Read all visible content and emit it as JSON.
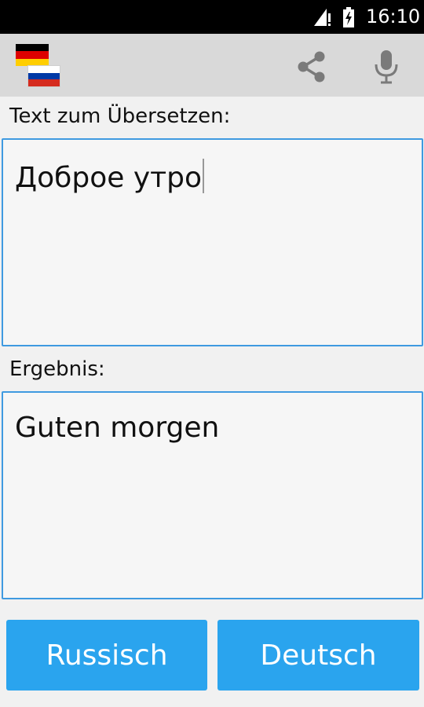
{
  "status_bar": {
    "time": "16:10",
    "icons": [
      "signal-icon",
      "battery-charging-icon"
    ]
  },
  "action_bar": {
    "language_pair_icon": "german-russian-flags-icon",
    "flags": {
      "de": [
        "#000000",
        "#dd0000",
        "#ffce00"
      ],
      "ru": [
        "#ffffff",
        "#0039a6",
        "#d52b1e"
      ]
    },
    "actions": [
      "share-icon",
      "microphone-icon"
    ]
  },
  "input": {
    "label": "Text zum Übersetzen:",
    "value": "Доброе утро"
  },
  "output": {
    "label": "Ergebnis:",
    "value": "Guten morgen"
  },
  "buttons": {
    "source_language": "Russisch",
    "target_language": "Deutsch"
  },
  "colors": {
    "accent": "#2aa4ee",
    "field_border": "#3f9ae0",
    "action_bar": "#d9d9d9",
    "background": "#f1f1f1"
  }
}
